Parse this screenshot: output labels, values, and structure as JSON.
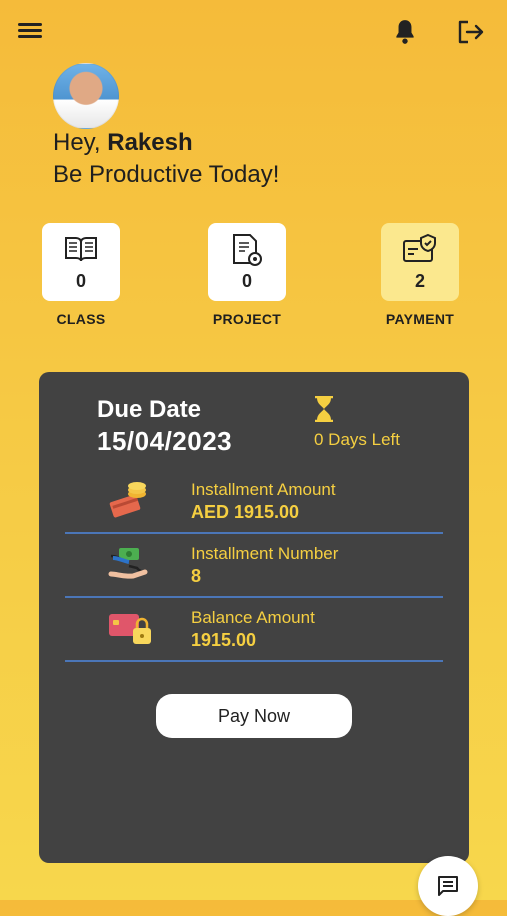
{
  "header": {
    "menu_icon": "menu-icon",
    "bell_icon": "bell-icon",
    "logout_icon": "logout-icon"
  },
  "user": {
    "greeting_prefix": "Hey,",
    "name": "Rakesh",
    "tagline": "Be Productive Today!"
  },
  "stats": [
    {
      "label": "CLASS",
      "count": "0",
      "icon": "book-icon"
    },
    {
      "label": "PROJECT",
      "count": "0",
      "icon": "document-gear-icon"
    },
    {
      "label": "PAYMENT",
      "count": "2",
      "icon": "payment-check-icon",
      "active": true
    }
  ],
  "payment_card": {
    "due_label": "Due Date",
    "due_date": "15/04/2023",
    "days_left": "0 Days Left",
    "rows": [
      {
        "title": "Installment Amount",
        "value": "AED 1915.00",
        "icon": "coins-card-icon"
      },
      {
        "title": "Installment Number",
        "value": "8",
        "icon": "hand-money-icon"
      },
      {
        "title": "Balance Amount",
        "value": "1915.00",
        "icon": "card-lock-icon"
      }
    ],
    "pay_button": "Pay Now"
  },
  "colors": {
    "accent": "#f5cf41",
    "card_bg": "#424242",
    "divider": "#4b76b8"
  },
  "fab": {
    "icon": "chat-icon"
  }
}
